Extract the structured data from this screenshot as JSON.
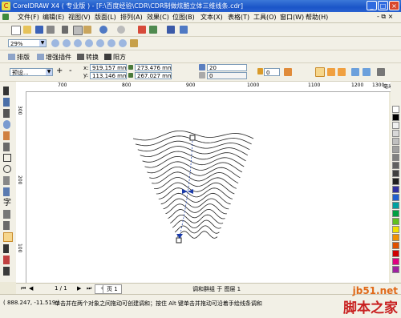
{
  "window": {
    "title": "CorelDRAW X4 ( 专业版 ) - [F:\\百度经验\\CDR\\CDR制做炫酷立体三维线条.cdr]",
    "minimize": "_",
    "maximize": "□",
    "close": "×"
  },
  "menu": {
    "items": [
      "文件(F)",
      "编辑(E)",
      "视图(V)",
      "版面(L)",
      "排列(A)",
      "效果(C)",
      "位图(B)",
      "文本(X)",
      "表格(T)",
      "工具(O)",
      "窗口(W)",
      "帮助(H)"
    ],
    "doc_controls": "- ⧉ ×"
  },
  "zoom": {
    "value": "29%"
  },
  "tabs": {
    "items": [
      "排版",
      "增强插件",
      "转换",
      "阳方"
    ]
  },
  "properties": {
    "preset": "预设...",
    "x": "919.157 mm",
    "y": "113.146 mm",
    "width": "273.476 mm",
    "height": "267.027 mm",
    "x_label": "x:",
    "y_label": "y:",
    "steps": "20",
    "spacing": "0",
    "angle_value": "0",
    "plus": "+",
    "minus": "-"
  },
  "ruler": {
    "h_labels": [
      "700",
      "800",
      "900",
      "1000",
      "1100",
      "1200",
      "1300"
    ],
    "unit": "毫米",
    "v_labels": [
      "300",
      "200",
      "100"
    ]
  },
  "colors": {
    "palette": [
      "#ffffff",
      "#000000",
      "#f0f0f0",
      "#d8d8d8",
      "#c0c0c0",
      "#a0a0a0",
      "#808080",
      "#606060",
      "#404040",
      "#202020",
      "#3030a0",
      "#2060d0",
      "#00a0a0",
      "#00a040",
      "#60c020",
      "#f0e000",
      "#f09000",
      "#e05000",
      "#d00000",
      "#e00080",
      "#a020a0"
    ],
    "accent": "#3b78d8"
  },
  "pagebar": {
    "counter": "1 / 1",
    "page_tab": "页 1",
    "layer_status": "调和群组 于 图层 1"
  },
  "status": {
    "coords": "( 888.247, -11.519 )",
    "hint": "单击并在两个对象之间拖动可创建调和；按住 Alt 键单击并拖动可沿着手绘线条调和"
  },
  "watermark": {
    "site": "jb51.net",
    "brand": "脚本之家"
  }
}
